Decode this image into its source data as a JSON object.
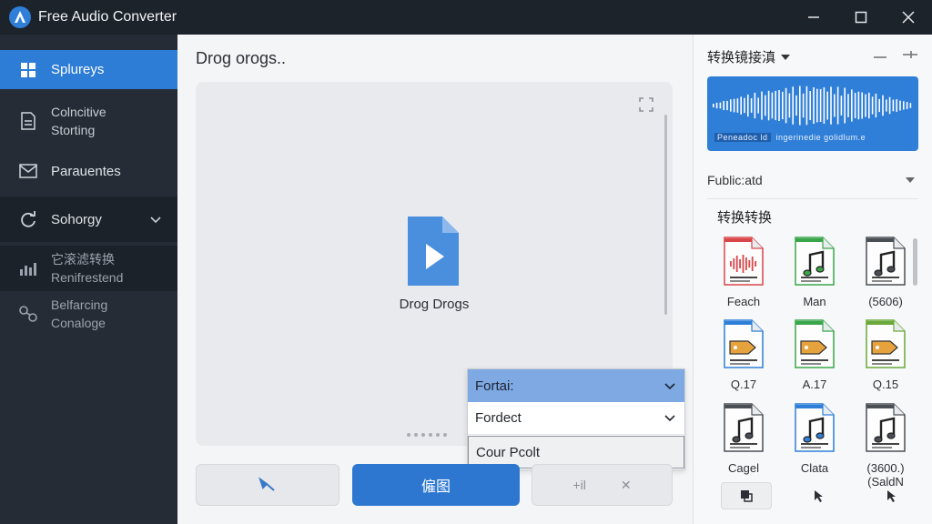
{
  "window": {
    "title": "Free Audio Converter",
    "logo_letter": "A"
  },
  "sidebar": {
    "items": [
      {
        "label": "Splureys",
        "icon": "grid-icon",
        "state": "active"
      },
      {
        "label": "Colncitive",
        "label2": "Storting",
        "icon": "document-icon",
        "state": "normal"
      },
      {
        "label": "Parauentes",
        "icon": "mail-icon",
        "state": "normal"
      },
      {
        "label": "Sohorgy",
        "icon": "refresh-icon",
        "state": "expanded"
      },
      {
        "label": "它滚滤转换",
        "label2": "Renifrestend",
        "icon": "chart-icon",
        "state": "dim"
      },
      {
        "label": "Belfarcing",
        "label2": "Conaloge",
        "icon": "link-icon",
        "state": "dim"
      }
    ]
  },
  "main": {
    "title": "Drog orogs..",
    "drop_label": "Drog Drogs",
    "dropdown": {
      "selected": "Fortai:",
      "option1": "Fordect",
      "option2": "Cour Pcolt"
    },
    "primary_button": "僱图",
    "right_button_text": "+il",
    "right_button_icon": "✕"
  },
  "right_panel": {
    "header": "转换镜接滇",
    "wave_caption_left": "Peneadoc ld",
    "wave_caption_right": "ingerinedie golidlum.e",
    "subheader": "Fublic:atd",
    "section_title": "转换转换",
    "formats": [
      {
        "label": "Feach",
        "icon": "waveform-file-icon",
        "color": "#d9464a"
      },
      {
        "label": "Man",
        "icon": "music-note-file-icon",
        "color": "#3aa64a"
      },
      {
        "label": "(5606)",
        "icon": "music-note-file-icon",
        "color": "#4a4e55"
      },
      {
        "label": "Q.17",
        "icon": "tag-file-icon",
        "color": "#2f7fd8"
      },
      {
        "label": "A.17",
        "icon": "tag-file-icon",
        "color": "#3aa64a"
      },
      {
        "label": "Q.15",
        "icon": "tag-file-icon",
        "color": "#6aa83a"
      },
      {
        "label": "Cagel",
        "icon": "music-note-file-icon",
        "color": "#4a4e55"
      },
      {
        "label": "Clata",
        "icon": "music-note-file-icon",
        "color": "#2f7fd8"
      },
      {
        "label": "(3600.)",
        "label2": "(SaldN",
        "icon": "music-note-file-icon",
        "color": "#4a4e55"
      }
    ]
  },
  "colors": {
    "accent": "#2d7cd6",
    "sidebar_bg": "#252c35",
    "titlebar_bg": "#1d232b"
  }
}
